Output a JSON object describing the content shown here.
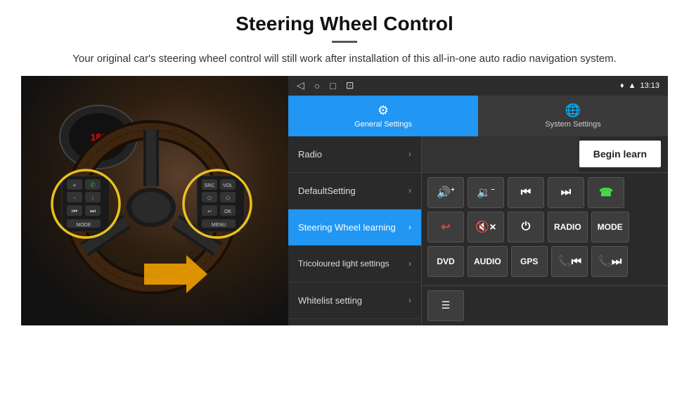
{
  "header": {
    "title": "Steering Wheel Control",
    "description": "Your original car's steering wheel control will still work after installation of this all-in-one auto radio navigation system."
  },
  "status_bar": {
    "time": "13:13",
    "nav_icons": [
      "◁",
      "○",
      "□",
      "⊡"
    ]
  },
  "tabs": [
    {
      "id": "general",
      "label": "General Settings",
      "active": true
    },
    {
      "id": "system",
      "label": "System Settings",
      "active": false
    }
  ],
  "menu_items": [
    {
      "id": "radio",
      "label": "Radio",
      "active": false
    },
    {
      "id": "default",
      "label": "DefaultSetting",
      "active": false
    },
    {
      "id": "steering",
      "label": "Steering Wheel learning",
      "active": true
    },
    {
      "id": "tricoloured",
      "label": "Tricoloured light settings",
      "active": false
    },
    {
      "id": "whitelist",
      "label": "Whitelist setting",
      "active": false
    }
  ],
  "begin_learn_label": "Begin learn",
  "control_buttons": {
    "row1": [
      {
        "id": "vol-up",
        "icon": "🔊+",
        "text": ""
      },
      {
        "id": "vol-down",
        "icon": "🔉−",
        "text": ""
      },
      {
        "id": "prev-track",
        "icon": "⏮",
        "text": ""
      },
      {
        "id": "next-track",
        "icon": "⏭",
        "text": ""
      },
      {
        "id": "phone",
        "icon": "📞",
        "text": ""
      }
    ],
    "row2": [
      {
        "id": "hang-up",
        "icon": "↩",
        "text": ""
      },
      {
        "id": "mute",
        "icon": "🔇×",
        "text": ""
      },
      {
        "id": "power",
        "icon": "⏻",
        "text": ""
      },
      {
        "id": "radio-btn",
        "icon": "",
        "text": "RADIO"
      },
      {
        "id": "mode-btn",
        "icon": "",
        "text": "MODE"
      }
    ],
    "row3": [
      {
        "id": "dvd-btn",
        "icon": "",
        "text": "DVD"
      },
      {
        "id": "audio-btn",
        "icon": "",
        "text": "AUDIO"
      },
      {
        "id": "gps-btn",
        "icon": "",
        "text": "GPS"
      },
      {
        "id": "phone-prev",
        "icon": "📞⏮",
        "text": ""
      },
      {
        "id": "phone-next",
        "icon": "📞⏭",
        "text": ""
      }
    ]
  },
  "whitelist_icon": "≡",
  "colors": {
    "active_tab": "#2196F3",
    "inactive_tab": "#3a3a3a",
    "active_menu": "#2196F3",
    "bg_dark": "#2a2a2a",
    "btn_bg": "#3d3d3d"
  }
}
